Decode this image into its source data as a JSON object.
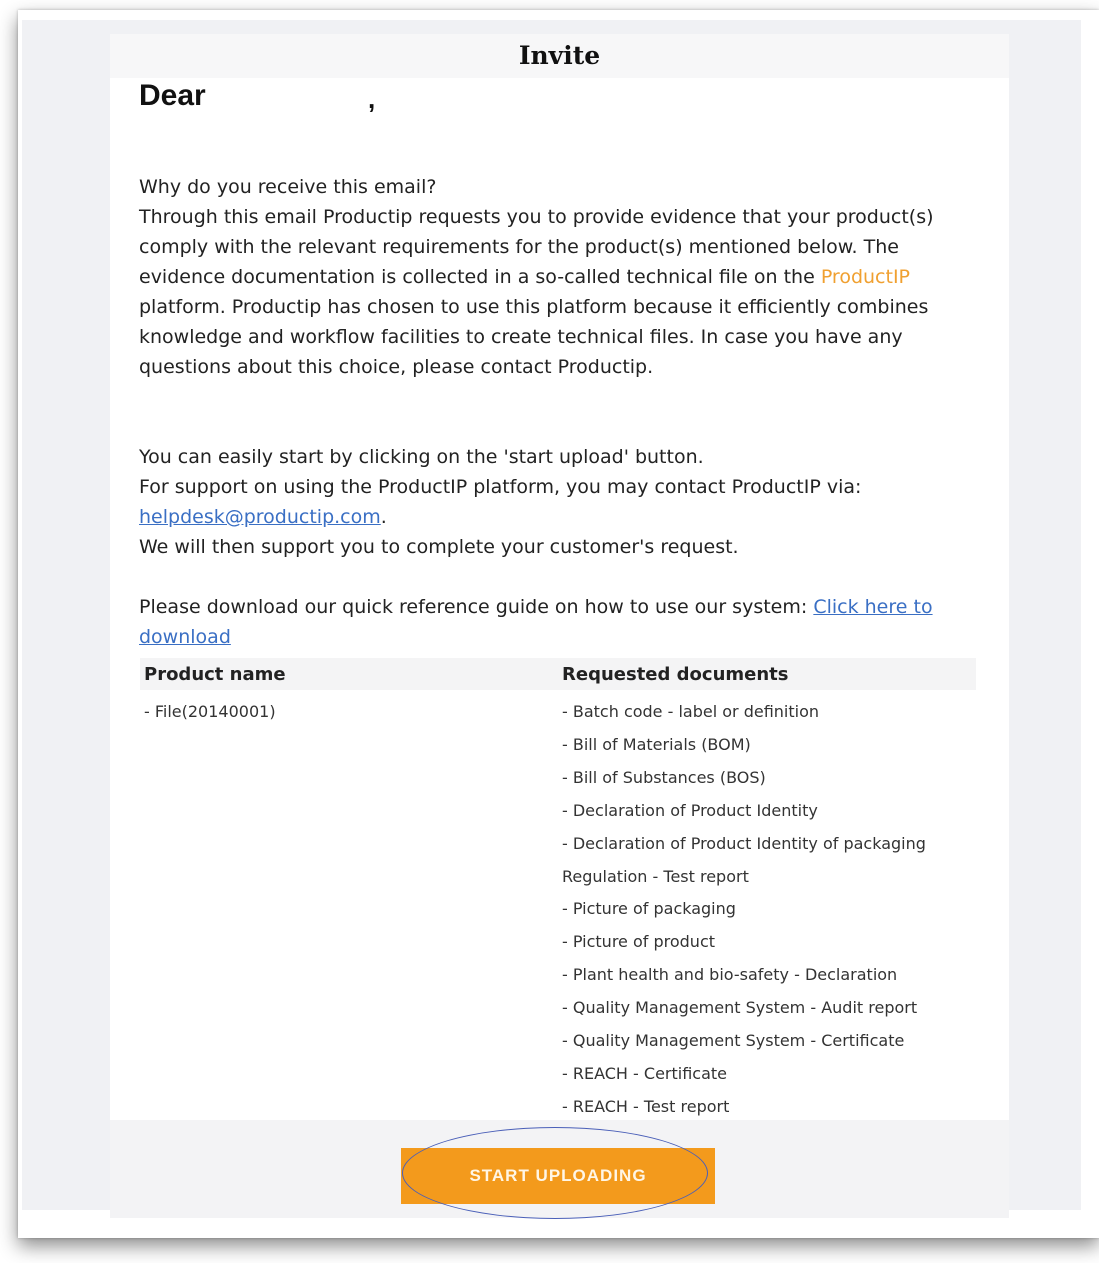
{
  "email": {
    "title": "Invite",
    "greeting": "Dear",
    "greeting_comma": ",",
    "question": "Why do you receive this email?",
    "intro_part1": "Through this email Productip requests you to provide evidence that your product(s) comply with the relevant requirements for the product(s) mentioned below. The evidence documentation is collected in a so-called technical file on the ",
    "intro_brand": "ProductIP",
    "intro_part2": " platform. Productip has chosen to use this platform because it efficiently combines knowledge and workflow facilities to create technical files. In case you have any questions about this choice, please contact Productip.",
    "start_hint": "You can easily start by clicking on the 'start upload' button.",
    "support_line": "For support on using the ProductIP platform, you may contact ProductIP via:",
    "support_email": "helpdesk@productip.com",
    "support_email_suffix": ".",
    "support_closing": "We will then support you to complete your customer's request.",
    "guide_text": "Please download our quick reference guide on how to use our system: ",
    "guide_link": "Click here to download"
  },
  "table": {
    "col_product": "Product name",
    "col_documents": "Requested documents",
    "product": "- File(20140001)",
    "documents": [
      "- Batch code - label or definition",
      "- Bill of Materials (BOM)",
      "- Bill of Substances (BOS)",
      "- Declaration of Product Identity",
      "- Declaration of Product Identity of packaging",
      "Regulation - Test report",
      "- Picture of packaging",
      "- Picture of product",
      "- Plant health and bio-safety - Declaration",
      "- Quality Management System - Audit report",
      "- Quality Management System - Certificate",
      "- REACH - Certificate",
      "- REACH - Test report"
    ]
  },
  "button": {
    "label": "START UPLOADING"
  },
  "colors": {
    "accent": "#f39a1c",
    "link": "#3a6fc4",
    "annotation": "#4a5fb8"
  }
}
